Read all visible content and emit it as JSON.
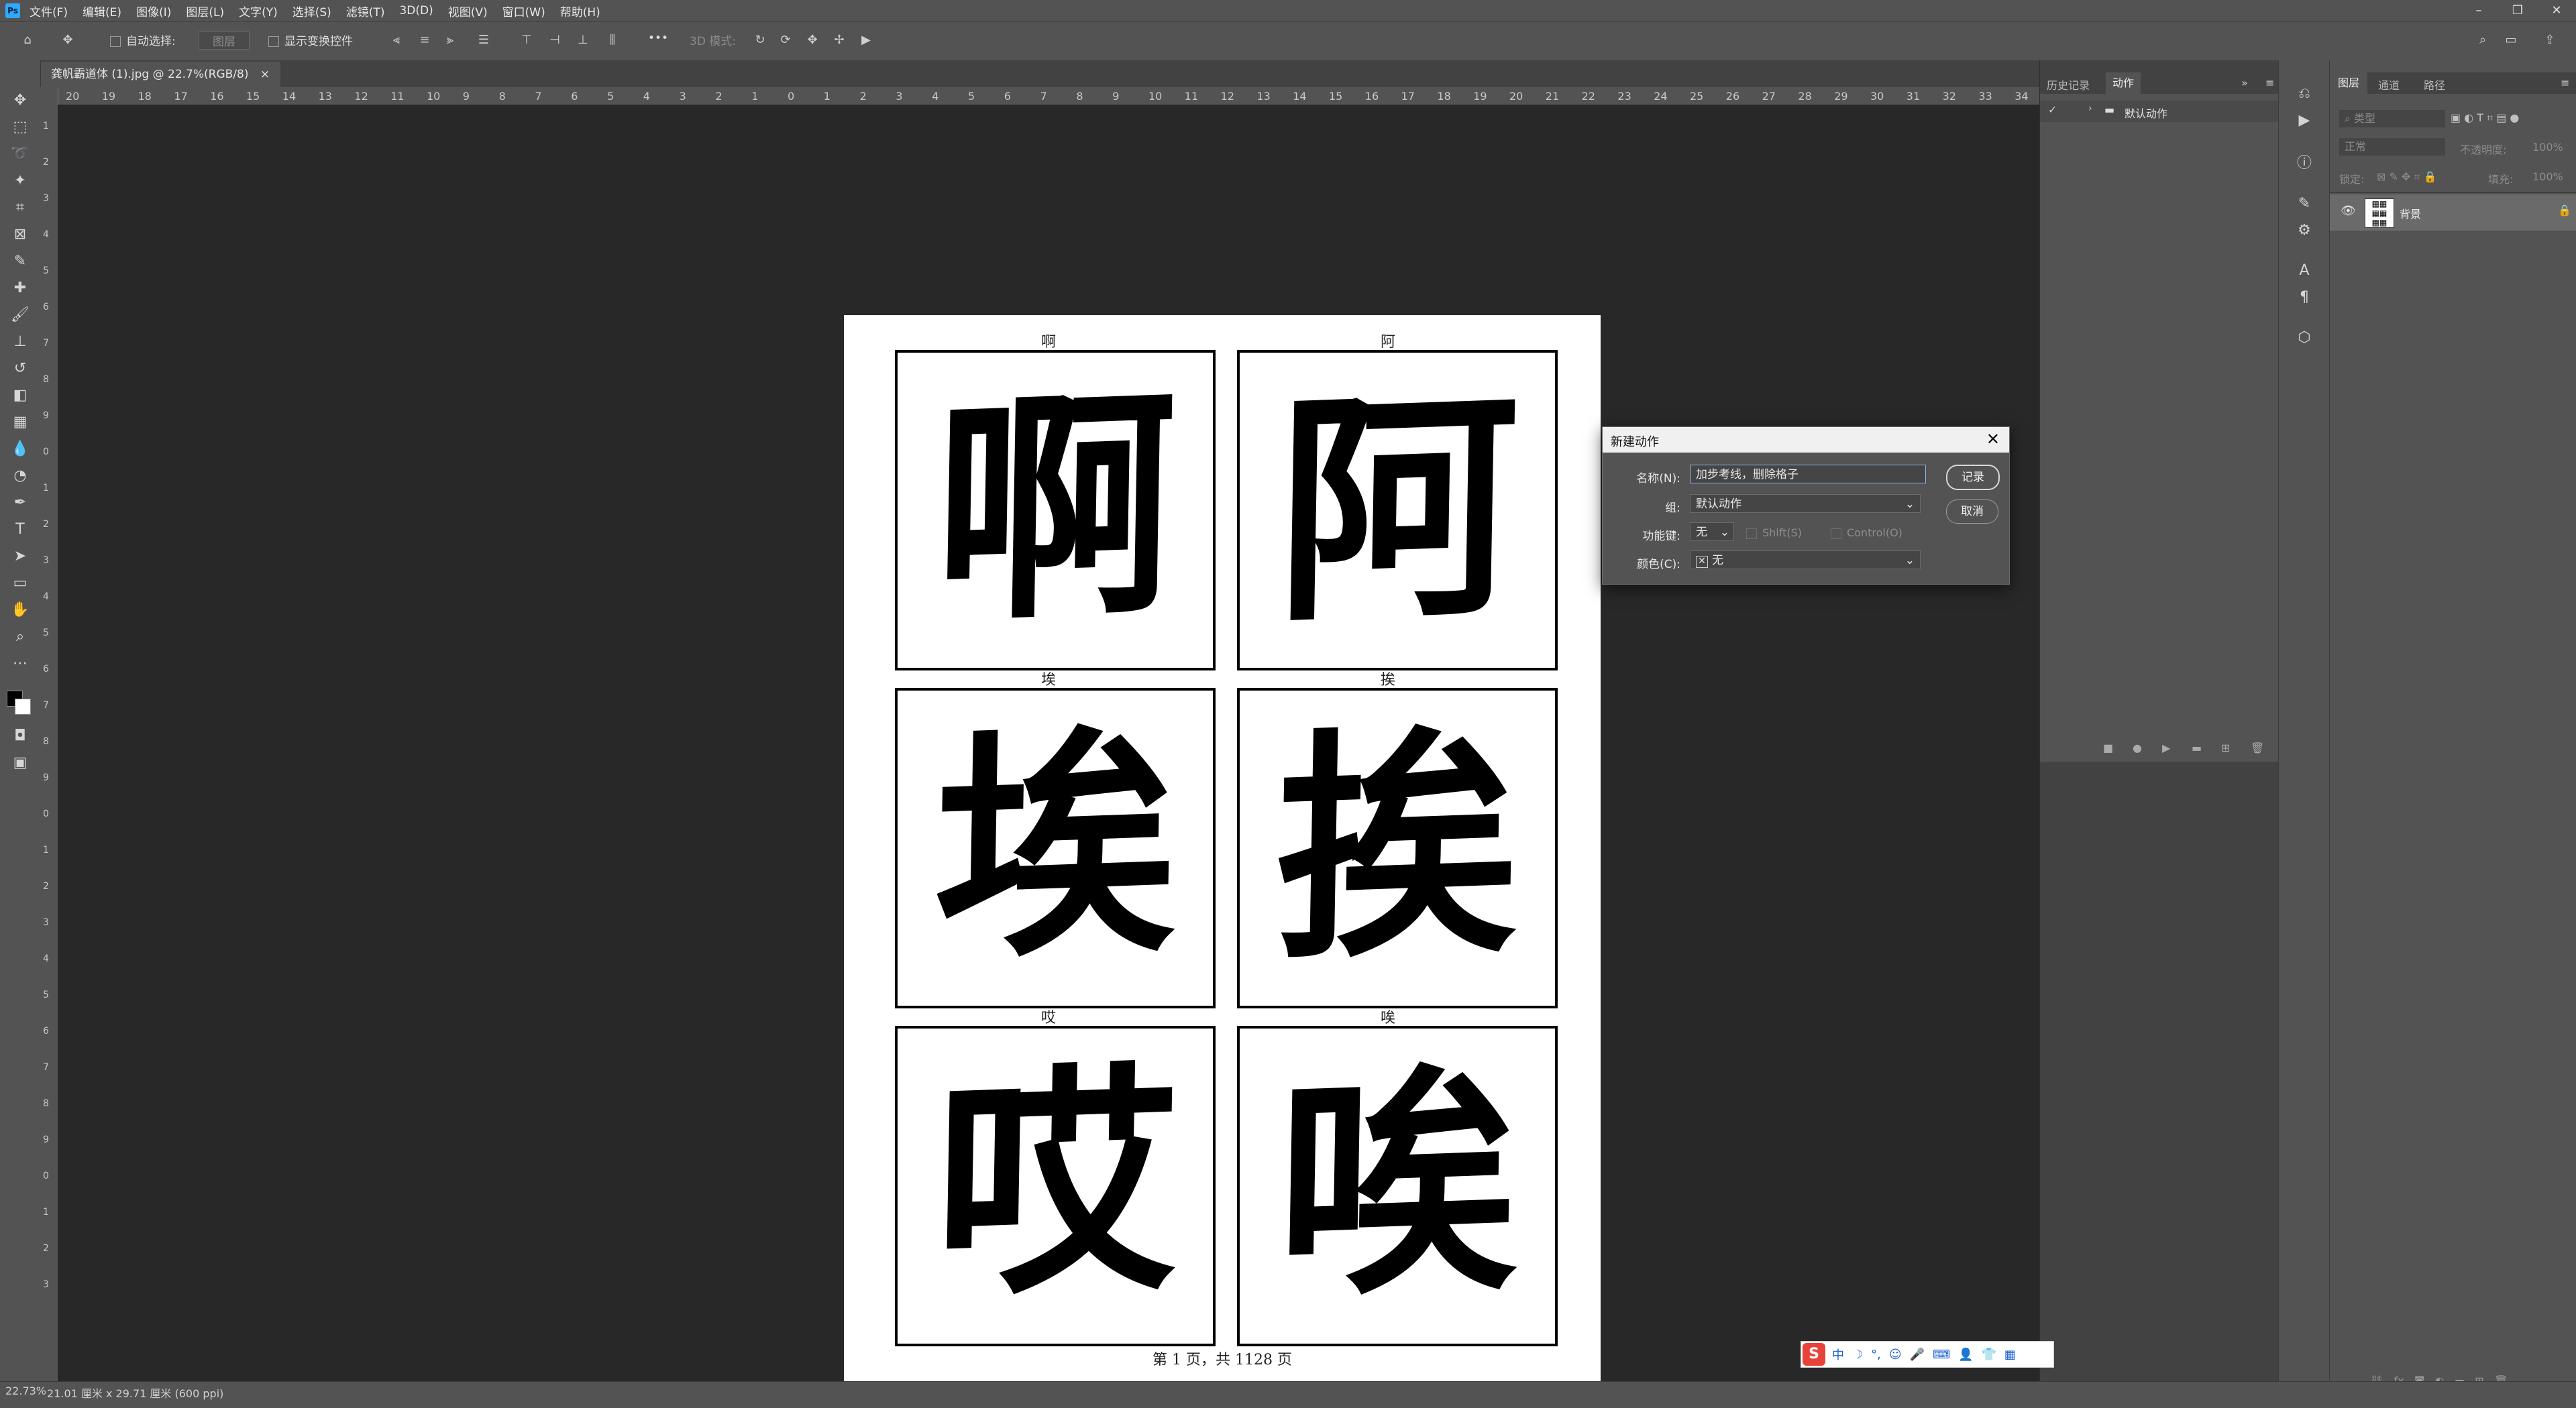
{
  "menu": {
    "logo": "Ps",
    "items": [
      "文件(F)",
      "编辑(E)",
      "图像(I)",
      "图层(L)",
      "文字(Y)",
      "选择(S)",
      "滤镜(T)",
      "3D(D)",
      "视图(V)",
      "窗口(W)",
      "帮助(H)"
    ]
  },
  "window_controls": [
    "–",
    "❐",
    "✕"
  ],
  "options": {
    "auto_select": "自动选择:",
    "auto_select_target": "图层",
    "show_transform": "显示变换控件",
    "mode_3d": "3D 模式:",
    "more": "•••"
  },
  "document_tab": {
    "title": "龚帆霸道体 (1).jpg @ 22.7%(RGB/8)",
    "close": "×"
  },
  "ruler_h": [
    "20",
    "19",
    "18",
    "17",
    "16",
    "15",
    "14",
    "13",
    "12",
    "11",
    "10",
    "9",
    "8",
    "7",
    "6",
    "5",
    "4",
    "3",
    "2",
    "1",
    "0",
    "1",
    "2",
    "3",
    "4",
    "5",
    "6",
    "7",
    "8",
    "9",
    "10",
    "11",
    "12",
    "13",
    "14",
    "15",
    "16",
    "17",
    "18",
    "19",
    "20",
    "21",
    "22",
    "23",
    "24",
    "25",
    "26",
    "27",
    "28",
    "29",
    "30",
    "31",
    "32",
    "33",
    "34"
  ],
  "ruler_v": [
    "1",
    "2",
    "3",
    "4",
    "5",
    "6",
    "7",
    "8",
    "9",
    "0",
    "1",
    "2",
    "3",
    "4",
    "5",
    "6",
    "7",
    "8",
    "9",
    "0",
    "1",
    "2",
    "3",
    "4",
    "5",
    "6",
    "7",
    "8",
    "9",
    "0",
    "1",
    "2",
    "3"
  ],
  "page": {
    "cells": [
      {
        "label": "啊",
        "glyph": "啊"
      },
      {
        "label": "阿",
        "glyph": "阿"
      },
      {
        "label": "埃",
        "glyph": "埃"
      },
      {
        "label": "挨",
        "glyph": "挨"
      },
      {
        "label": "哎",
        "glyph": "哎"
      },
      {
        "label": "唉",
        "glyph": "唉"
      }
    ],
    "footer": "第 1 页，共 1128 页"
  },
  "actions_panel": {
    "tabs": [
      "历史记录",
      "动作"
    ],
    "set_name": "默认动作"
  },
  "layers_panel": {
    "tabs": [
      "图层",
      "通道",
      "路径"
    ],
    "filter_placeholder": "类型",
    "blend_mode": "正常",
    "opacity_label": "不透明度:",
    "opacity_value": "100%",
    "lock_label": "锁定:",
    "fill_label": "填充:",
    "fill_value": "100%",
    "layer_name": "背景"
  },
  "dialog": {
    "title": "新建动作",
    "name_label": "名称(N):",
    "name_value": "加步考线，删除格子",
    "group_label": "组:",
    "group_value": "默认动作",
    "fkey_label": "功能键:",
    "fkey_value": "无",
    "shift_label": "Shift(S)",
    "control_label": "Control(O)",
    "color_label": "颜色(C):",
    "color_value": "无",
    "record_button": "记录",
    "cancel_button": "取消"
  },
  "status": {
    "zoom": "22.73%",
    "doc_size": "21.01 厘米 x 29.71 厘米 (600 ppi)"
  },
  "ime": {
    "logo": "S",
    "mode": "中",
    "items": [
      "☽",
      "°,",
      "☺",
      "🎤",
      "⌨",
      "👤",
      "👕",
      "▦"
    ]
  },
  "colors": {
    "accent": "#31a8ff",
    "app_bg": "#535353",
    "canvas_bg": "#282828",
    "panel_dark": "#424242"
  }
}
